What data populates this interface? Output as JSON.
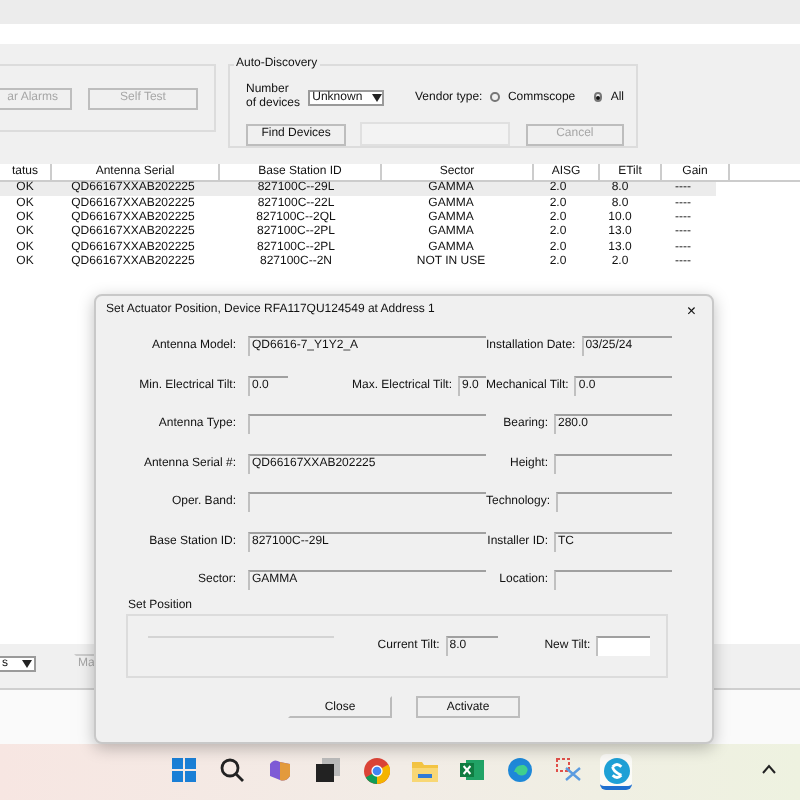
{
  "top_panel": {
    "buttons": [
      "ar Alarms",
      "Self Test"
    ]
  },
  "auto_discovery": {
    "title": "Auto-Discovery",
    "devices_label": "Number of devices",
    "devices_value": "Unknown",
    "vendor_label": "Vendor type:",
    "vendor_options": [
      {
        "label": "Commscope",
        "selected": false
      },
      {
        "label": "All",
        "selected": true
      }
    ],
    "find_button": "Find Devices",
    "progress": {
      "level": 0
    },
    "cancel_button": "Cancel"
  },
  "table": {
    "columns": [
      "tatus",
      "Antenna Serial",
      "Base Station ID",
      "Sector",
      "AISG",
      "ETilt",
      "Gain"
    ],
    "rows": [
      {
        "selected": true,
        "cells": [
          "OK",
          "QD66167XXAB202225",
          "827100C--29L",
          "GAMMA",
          "2.0",
          "8.0",
          "----"
        ]
      },
      {
        "selected": false,
        "cells": [
          "OK",
          "QD66167XXAB202225",
          "827100C--22L",
          "GAMMA",
          "2.0",
          "8.0",
          "----"
        ]
      },
      {
        "selected": false,
        "cells": [
          "OK",
          "QD66167XXAB202225",
          "827100C--2QL",
          "GAMMA",
          "2.0",
          "10.0",
          "----"
        ]
      },
      {
        "selected": false,
        "cells": [
          "OK",
          "QD66167XXAB202225",
          "827100C--2PL",
          "GAMMA",
          "2.0",
          "13.0",
          "----"
        ]
      },
      {
        "selected": false,
        "cells": [
          "OK",
          "QD66167XXAB202225",
          "827100C--2PL",
          "GAMMA",
          "2.0",
          "13.0",
          "----"
        ]
      },
      {
        "selected": false,
        "cells": [
          "OK",
          "QD66167XXAB202225",
          "827100C--2N",
          "NOT IN USE",
          "2.0",
          "2.0",
          "----"
        ]
      }
    ]
  },
  "bottom_bar": {
    "dropdown_value": "s",
    "button": "Ma"
  },
  "dialog": {
    "title": "Set Actuator Position, Device RFA117QU124549 at Address 1",
    "close_glyph": "×",
    "rows": [
      {
        "left": [
          {
            "label": "Antenna Model:",
            "value": "QD6616-7_Y1Y2_A",
            "kind": "wide"
          }
        ],
        "right": {
          "label": "Installation Date:",
          "value": "03/25/24"
        }
      },
      {
        "left": [
          {
            "label": "Min. Electrical Tilt:",
            "value": "0.0",
            "kind": "short"
          },
          {
            "label": "Max. Electrical Tilt:",
            "value": "9.0",
            "kind": "tiny"
          }
        ],
        "right": {
          "label": "Mechanical Tilt:",
          "value": "0.0"
        }
      },
      {
        "left": [
          {
            "label": "Antenna Type:",
            "kind": "wide"
          }
        ],
        "right": {
          "label": "Bearing:",
          "value": "280.0"
        }
      },
      {
        "left": [
          {
            "label": "Antenna Serial #:",
            "value": "QD66167XXAB202225",
            "kind": "wide"
          }
        ],
        "right": {
          "label": "Height:"
        }
      },
      {
        "left": [
          {
            "label": "Oper. Band:",
            "kind": "wide"
          }
        ],
        "right": {
          "label": "Technology:"
        }
      },
      {
        "left": [
          {
            "label": "Base Station ID:",
            "value": "827100C--29L",
            "kind": "wide"
          }
        ],
        "right": {
          "label": "Installer ID:",
          "value": "TC"
        }
      },
      {
        "left": [
          {
            "label": "Sector:",
            "value": "GAMMA",
            "kind": "wide"
          }
        ],
        "right": {
          "label": "Location:"
        }
      }
    ],
    "set_position": {
      "title": "Set Position",
      "current_label": "Current Tilt:",
      "current_value": "8.0",
      "new_label": "New Tilt:"
    },
    "buttons": [
      "Close",
      "Activate"
    ]
  },
  "taskbar": {
    "apps": [
      {
        "kind": "start",
        "selected": false
      },
      {
        "kind": "search",
        "selected": false
      },
      {
        "kind": "copilot",
        "selected": false
      },
      {
        "kind": "taskview",
        "selected": false
      },
      {
        "kind": "chrome",
        "selected": false
      },
      {
        "kind": "folder",
        "selected": false
      },
      {
        "kind": "excel",
        "selected": false
      },
      {
        "kind": "edge",
        "selected": false
      },
      {
        "kind": "snip",
        "selected": false
      },
      {
        "kind": "app",
        "selected": true
      }
    ]
  }
}
